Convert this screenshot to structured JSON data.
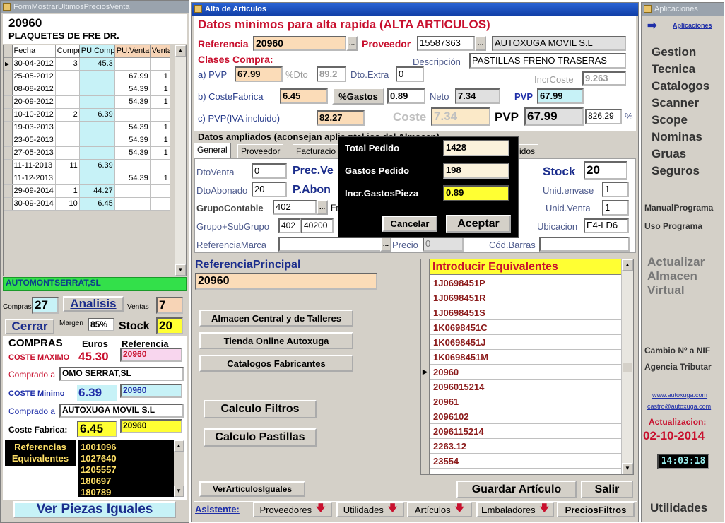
{
  "left": {
    "title": "FormMostrarUltimosPreciosVenta",
    "code": "20960",
    "name": "PLAQUETES DE FRE DR.",
    "columns": [
      "Fecha",
      "Compra",
      "PU.Compra",
      "PU.Venta",
      "Venta"
    ],
    "rows": [
      [
        "30-04-2012",
        "3",
        "45.3",
        "",
        ""
      ],
      [
        "25-05-2012",
        "",
        "",
        "67.99",
        "1"
      ],
      [
        "08-08-2012",
        "",
        "",
        "54.39",
        "1"
      ],
      [
        "20-09-2012",
        "",
        "",
        "54.39",
        "1"
      ],
      [
        "10-10-2012",
        "2",
        "6.39",
        "",
        ""
      ],
      [
        "19-03-2013",
        "",
        "",
        "54.39",
        "1"
      ],
      [
        "23-05-2013",
        "",
        "",
        "54.39",
        "1"
      ],
      [
        "27-05-2013",
        "",
        "",
        "54.39",
        "1"
      ],
      [
        "11-11-2013",
        "11",
        "6.39",
        "",
        ""
      ],
      [
        "11-12-2013",
        "",
        "",
        "54.39",
        "1"
      ],
      [
        "29-09-2014",
        "1",
        "44.27",
        "",
        ""
      ],
      [
        "30-09-2014",
        "10",
        "6.45",
        "",
        ""
      ]
    ],
    "supplier_bar": "AUTOMONTSERRAT,SL",
    "compras_label": "Compras",
    "compras_value": "27",
    "analisis_label": "Analisis",
    "ventas_label": "Ventas",
    "ventas_value": "7",
    "cerrar_label": "Cerrar",
    "margen_label": "Margen",
    "margen_value": "85%",
    "stock_label": "Stock",
    "stock_value": "20",
    "compras_title": "COMPRAS",
    "euros_title": "Euros",
    "referencia_title": "Referencia",
    "coste_maximo_label": "COSTE MAXIMO",
    "coste_maximo_value": "45.30",
    "coste_maximo_ref": "20960",
    "comprado_a_label": "Comprado a",
    "comprado_a_1": "OMO    SERRAT,SL",
    "coste_minimo_label": "COSTE Minimo",
    "coste_minimo_value": "6.39",
    "coste_minimo_ref": "20960",
    "comprado_a_2": "AUTOXUGA MOVIL S.L",
    "coste_fabrica_label": "Coste Fabrica:",
    "coste_fabrica_value": "6.45",
    "coste_fabrica_ref": "20960",
    "ref_equiv_label": "Referencias Equivalentes",
    "ref_equiv_list": [
      "1001096",
      "1027640",
      "1205557",
      "180697",
      "180789"
    ],
    "ver_piezas_label": "Ver Piezas Iguales"
  },
  "main": {
    "title": "Alta de Artículos",
    "heading": "Datos minimos para alta rapida (ALTA ARTICULOS)",
    "referencia_label": "Referencia",
    "referencia_value": "20960",
    "proveedor_label": "Proveedor",
    "proveedor_value": "15587363",
    "proveedor_name": "AUTOXUGA MOVIL S.L",
    "clases_compra": "Clases Compra:",
    "descripcion_label": "Descripción",
    "descripcion_value": "PASTILLAS FRENO TRASERAS",
    "a_pvp_label": "a) PVP",
    "a_pvp_value": "67.99",
    "dto_label": "%Dto",
    "dto_value": "89.2",
    "dto_extra_label": "Dto.Extra",
    "dto_extra_value": "0",
    "incr_coste_label": "IncrCoste",
    "incr_coste_value": "9.263",
    "b_label": "b) CosteFabrica",
    "b_value": "6.45",
    "gastos_btn": "%Gastos",
    "gastos_value": "0.89",
    "neto_label": "Neto",
    "neto_value": "7.34",
    "pvp_label": "PVP",
    "pvp_value": "67.99",
    "c_label": "c) PVP(IVA incluido)",
    "c_value": "82.27",
    "coste_label": "Coste",
    "coste_value": "7.34",
    "pvp2_label": "PVP",
    "pvp2_value": "67.99",
    "pct_value": "826.29",
    "pct_sign": "%",
    "datos_ampliados": "Datos ampliados (aconsejan    aplic           ntal        ios del Almacen)",
    "tabs": [
      "General",
      "Proveedor",
      "Facturacio",
      "",
      "idos"
    ],
    "dtoventa_label": "DtoVenta",
    "dtoventa_value": "0",
    "prec_ve_label": "Prec.Ve",
    "stock_label": "Stock",
    "stock_value": "20",
    "dtoabonado_label": "DtoAbonado",
    "dtoabonado_value": "20",
    "p_abon_label": "P.Abon",
    "unid_envase_label": "Unid.envase",
    "unid_envase_value": "1",
    "grupo_label": "GrupoContable",
    "grupo_value": "402",
    "fr_label": "Fr",
    "unid_venta_label": "Unid.Venta",
    "unid_venta_value": "1",
    "grupo_sub_label": "Grupo+SubGrupo",
    "grupo_sub_1": "402",
    "grupo_sub_2": "40200",
    "ubicacion_label": "Ubicacion",
    "ubicacion_value": "E4-LD6",
    "ref_marca_label": "ReferenciaMarca",
    "precio_label": "Precio",
    "precio_value": "0",
    "cod_barras_label": "Cód.Barras",
    "ref_principal_label": "ReferenciaPrincipal",
    "ref_principal_value": "20960",
    "btn_almacen": "Almacen Central y de Talleres",
    "btn_tienda": "Tienda Online Autoxuga",
    "btn_catalogos": "Catalogos Fabricantes",
    "btn_filtros": "Calculo Filtros",
    "btn_pastillas": "Calculo Pastillas",
    "btn_ver_iguales": "VerArticulosIguales",
    "equiv_header": "Introducir Equivalentes",
    "equiv_list": [
      "1J0698451P",
      "1J0698451R",
      "1J0698451S",
      "1K0698451C",
      "1K0698451J",
      "1K0698451M",
      "20960",
      "2096015214",
      "20961",
      "2096102",
      "2096115214",
      "2263.12",
      "23554"
    ],
    "guardar_label": "Guardar Artículo",
    "salir_label": "Salir",
    "asistente_label": "Asistente:",
    "bottom_buttons": [
      "Proveedores",
      "Utilidades",
      "Artículos",
      "Embaladores"
    ],
    "precios_filtros": "PreciosFiltros"
  },
  "dialog": {
    "total_pedido_label": "Total Pedido",
    "total_pedido_value": "1428",
    "gastos_pedido_label": "Gastos Pedido",
    "gastos_pedido_value": "198",
    "incr_label": "Incr.GastosPieza",
    "incr_value": "0.89",
    "cancelar": "Cancelar",
    "aceptar": "Aceptar"
  },
  "right": {
    "title": "Aplicaciones",
    "aplicaciones_link": "Aplicaciones",
    "items": [
      "Gestion",
      "Tecnica",
      "Catalogos",
      "Scanner",
      "Scope",
      "Nominas",
      "Gruas",
      "Seguros"
    ],
    "manual": "ManualPrograma",
    "uso": "Uso Programa",
    "actualizar": "Actualizar Almacen Virtual",
    "cambio": "Cambio Nº a NIF",
    "agencia": "Agencia Tributar",
    "web": "www.autoxuga.com",
    "email": "castro@autoxuga.com",
    "actualizacion_label": "Actualizacion:",
    "actualizacion_date": "02-10-2014",
    "clock": "14:03:18",
    "utilidades": "Utilidades"
  }
}
